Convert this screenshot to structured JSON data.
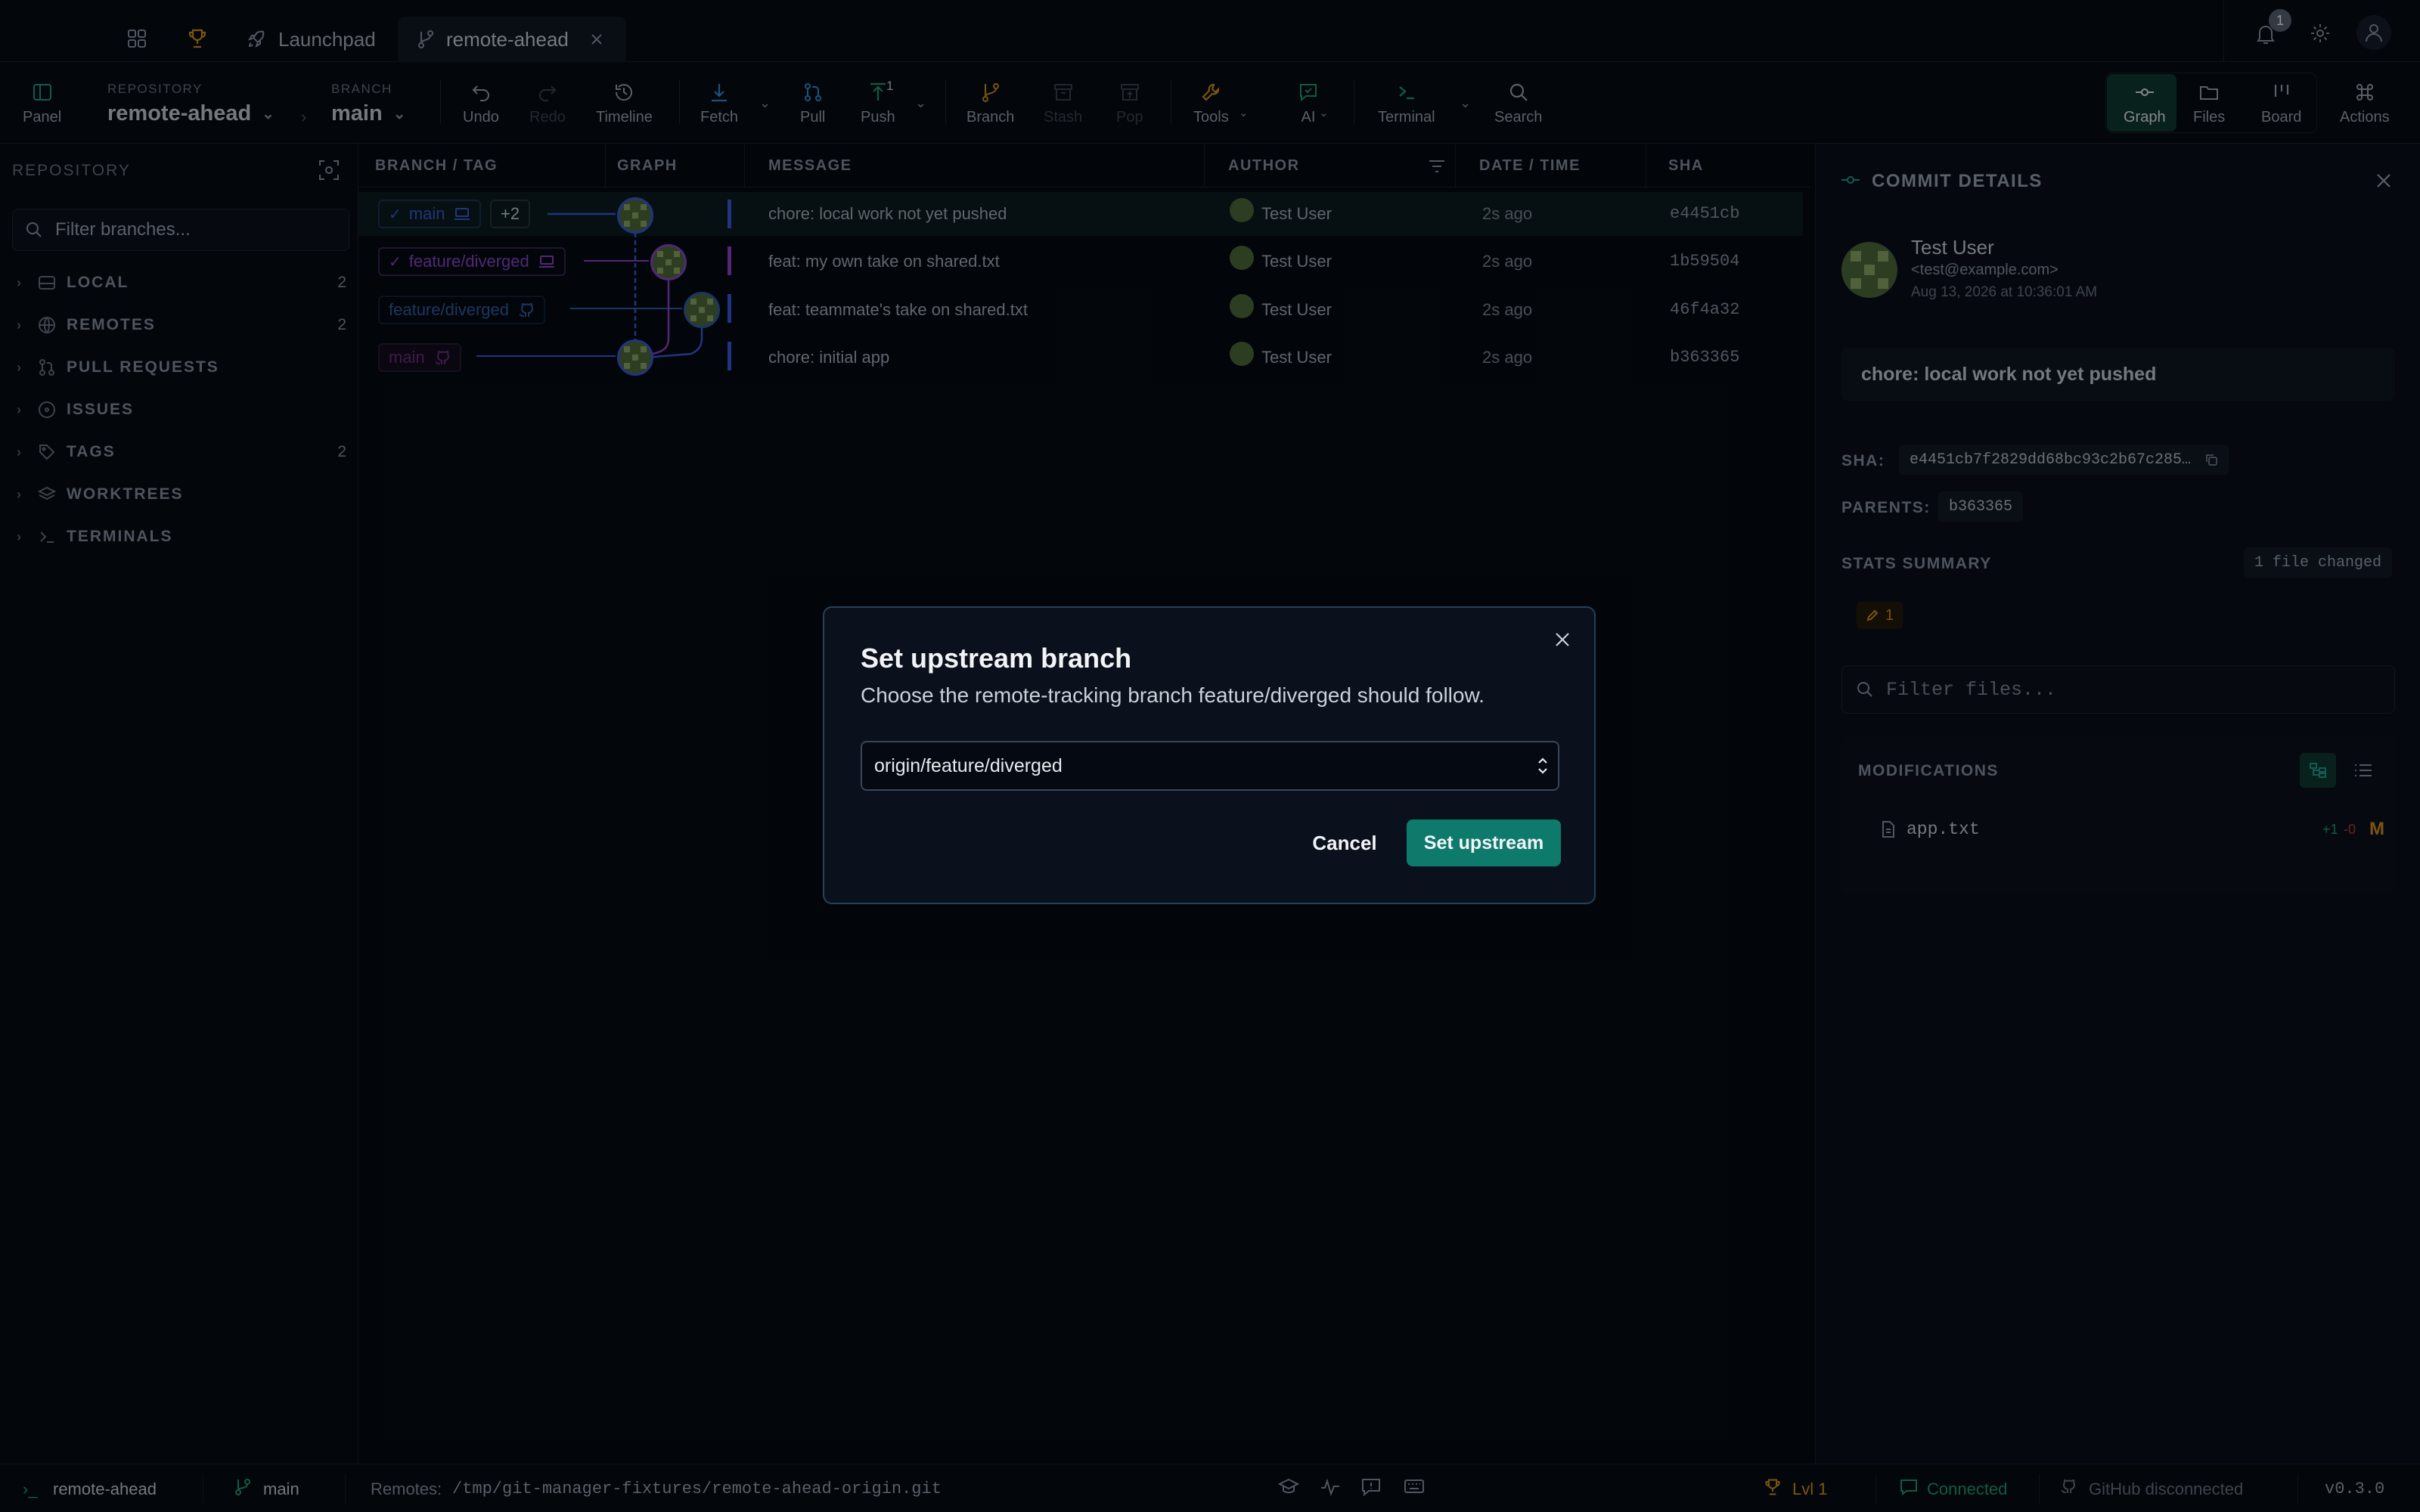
{
  "tabs": [
    {
      "label": "Launchpad"
    },
    {
      "label": "remote-ahead"
    }
  ],
  "notifications": {
    "count": "1"
  },
  "toolbar": {
    "panel": "Panel",
    "repository_caption": "REPOSITORY",
    "repository_name": "remote-ahead",
    "branch_caption": "BRANCH",
    "branch_name": "main",
    "undo": "Undo",
    "redo": "Redo",
    "timeline": "Timeline",
    "fetch": "Fetch",
    "pull": "Pull",
    "push": "Push",
    "push_badge": "1",
    "branch": "Branch",
    "stash": "Stash",
    "pop": "Pop",
    "tools": "Tools",
    "ai": "AI",
    "terminal": "Terminal",
    "search": "Search",
    "graph": "Graph",
    "files": "Files",
    "board": "Board",
    "actions": "Actions"
  },
  "sidebar": {
    "title": "REPOSITORY",
    "filter_placeholder": "Filter branches...",
    "sections": [
      {
        "label": "LOCAL",
        "count": "2"
      },
      {
        "label": "REMOTES",
        "count": "2"
      },
      {
        "label": "PULL REQUESTS",
        "count": ""
      },
      {
        "label": "ISSUES",
        "count": ""
      },
      {
        "label": "TAGS",
        "count": "2"
      },
      {
        "label": "WORKTREES",
        "count": ""
      },
      {
        "label": "TERMINALS",
        "count": ""
      }
    ]
  },
  "table": {
    "columns": [
      "BRANCH / TAG",
      "GRAPH",
      "MESSAGE",
      "AUTHOR",
      "DATE / TIME",
      "SHA"
    ],
    "more_refs": "+2",
    "rows": [
      {
        "ref": "main",
        "message": "chore: local work not yet pushed",
        "author": "Test User",
        "date": "2s ago",
        "sha": "e4451cb"
      },
      {
        "ref": "feature/diverged",
        "message": "feat: my own take on shared.txt",
        "author": "Test User",
        "date": "2s ago",
        "sha": "1b59504"
      },
      {
        "ref": "feature/diverged",
        "message": "feat: teammate's take on shared.txt",
        "author": "Test User",
        "date": "2s ago",
        "sha": "46f4a32"
      },
      {
        "ref": "main",
        "message": "chore: initial app",
        "author": "Test User",
        "date": "2s ago",
        "sha": "b363365"
      }
    ]
  },
  "details": {
    "title": "COMMIT DETAILS",
    "author": "Test User",
    "email": "<test@example.com>",
    "date": "Aug 13, 2026 at 10:36:01 AM",
    "message": "chore: local work not yet pushed",
    "sha_label": "SHA:",
    "sha": "e4451cb7f2829dd68bc93c2b67c285…",
    "parents_label": "PARENTS:",
    "parent": "b363365",
    "stats_label": "STATS SUMMARY",
    "files_changed": "1 file changed",
    "modified_count": "1",
    "filter_placeholder": "Filter files...",
    "modifications_label": "MODIFICATIONS",
    "file_name": "app.txt",
    "additions": "+1",
    "deletions": "-0",
    "file_status": "M"
  },
  "statusbar": {
    "repo": "remote-ahead",
    "branch": "main",
    "remotes_label": "Remotes:",
    "remotes_path": "/tmp/git-manager-fixtures/remote-ahead-origin.git",
    "level": "Lvl 1",
    "connected": "Connected",
    "github": "GitHub disconnected",
    "version": "v0.3.0"
  },
  "modal": {
    "title": "Set upstream branch",
    "description": "Choose the remote-tracking branch feature/diverged should follow.",
    "selected": "origin/feature/diverged",
    "cancel": "Cancel",
    "confirm": "Set upstream"
  },
  "colors": {
    "accent": "#0d7a6c",
    "branch_blue": "#3b5bdb",
    "branch_purple": "#8e44c8",
    "remote_blue": "#2f5fa8",
    "warning": "#d4911a",
    "success": "#1f9e6e"
  }
}
